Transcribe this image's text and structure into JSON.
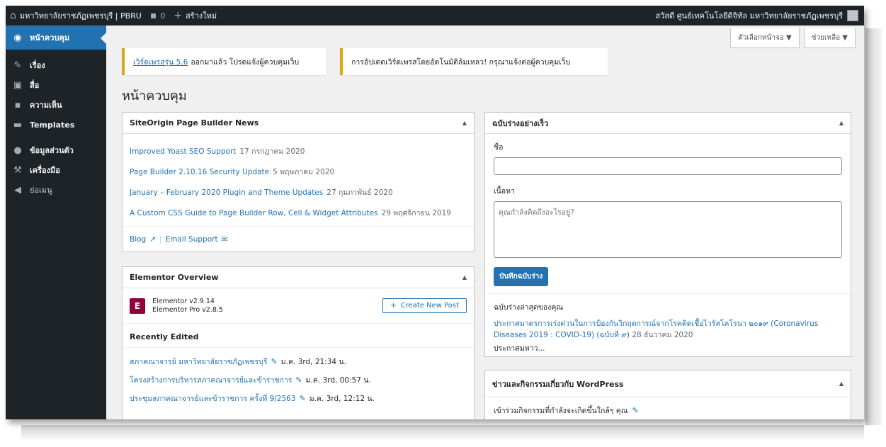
{
  "adminbar": {
    "site_name": "มหาวิทยาลัยราชภัฏเพชรบุรี | PBRU",
    "comments_count": "0",
    "new_label": "สร้างใหม่",
    "greeting": "สวัสดี ศูนย์เทคโนโลยีดิจิทัล มหาวิทยาลัยราชภัฏเพชรบุรี"
  },
  "sidebar": {
    "items": [
      {
        "label": "หน้าควบคุม",
        "icon": "dashboard-icon"
      },
      {
        "label": "เรื่อง",
        "icon": "pin-icon"
      },
      {
        "label": "สื่อ",
        "icon": "media-icon"
      },
      {
        "label": "ความเห็น",
        "icon": "comment-icon"
      },
      {
        "label": "Templates",
        "icon": "folder-icon"
      },
      {
        "label": "ข้อมูลส่วนตัว",
        "icon": "user-icon"
      },
      {
        "label": "เครื่องมือ",
        "icon": "wrench-icon"
      },
      {
        "label": "ย่อเมนู",
        "icon": "collapse-icon"
      }
    ]
  },
  "screen": {
    "options_label": "ตัวเลือกหน้าจอ ▼",
    "help_label": "ช่วยเหลือ ▼"
  },
  "notices": {
    "update_link": "เวิร์ดเพรสรุ่น 5.6",
    "update_text": "ออกมาแล้ว โปรดแจ้งผู้ควบคุมเว็บ",
    "auto_update_failed": "การอัปเดตเวิร์ดเพรสโดยอัตโนมัติล้มเหลว! กรุณาแจ้งต่อผู้ควบคุมเว็บ"
  },
  "page_title": "หน้าควบคุม",
  "siteorigin": {
    "title": "SiteOrigin Page Builder News",
    "items": [
      {
        "title": "Improved Yoast SEO Support",
        "date": "17 กรกฎาคม 2020"
      },
      {
        "title": "Page Builder 2.10.16 Security Update",
        "date": "5 พฤษภาคม 2020"
      },
      {
        "title": "January – February 2020 Plugin and Theme Updates",
        "date": "27 กุมภาพันธ์ 2020"
      },
      {
        "title": "A Custom CSS Guide to Page Builder Row, Cell & Widget Attributes",
        "date": "29 พฤศจิกายน 2019"
      }
    ],
    "blog_label": "Blog",
    "email_label": "Email Support"
  },
  "elementor": {
    "title": "Elementor Overview",
    "version": "Elementor v2.9.14",
    "pro_version": "Elementor Pro v2.8.5",
    "create_label": "Create New Post",
    "recently_edited": "Recently Edited",
    "items": [
      {
        "title": "สภาคณาจารย์ มหาวิทยาลัยราชภัฏเพชรบุรี",
        "date": "ม.ค. 3rd, 21:34 น."
      },
      {
        "title": "โครงสร้างการบริหารสภาคณาจารย์และข้าราชการ",
        "date": "ม.ค. 3rd, 00:57 น."
      },
      {
        "title": "ประชุมสภาคณาจารย์และข้าราชการ ครั้งที่ 9/2563",
        "date": "ม.ค. 3rd, 12:12 น."
      }
    ]
  },
  "quickdraft": {
    "title": "ฉบับร่างอย่างเร็ว",
    "name_label": "ชื่อ",
    "content_label": "เนื้อหา",
    "content_placeholder": "คุณกำลังคิดถึงอะไรอยู่?",
    "save_label": "บันทึกฉบับร่าง",
    "recent_title": "ฉบับร่างล่าสุดของคุณ",
    "draft_title": "ประกาศมาตรการเร่งด่วนในการป้องกันวิกฤตการณ์จากโรคติดเชื้อไวรัสโคโรนา ๒๐๑๙ (Coronavirus Diseases 2019 : COVID-19) (ฉบับที่ ๙)",
    "draft_date": "28 ธันวาคม 2020",
    "draft_excerpt": "ประกาศมหาว..."
  },
  "wpnews": {
    "title": "ข่าวและกิจกรรมเกี่ยวกับ WordPress",
    "events_text": "เข้าร่วมกิจกรรมที่กำลังจะเกิดขึ้นใกล้ๆ คุณ"
  }
}
